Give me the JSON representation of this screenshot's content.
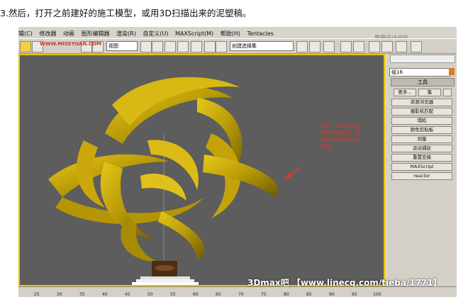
{
  "caption": "3.然后，打开之前建好的施工模型，或用3D扫描出来的泥塑稿。",
  "menu": [
    "辑(C)",
    "修改器",
    "动画",
    "图形编辑器",
    "渲染(R)",
    "自定义(U)",
    "MAXScript(M)",
    "帮助(H)",
    "Tentacles"
  ],
  "top_watermark": "思缘设计论坛",
  "toolbar": {
    "view_dropdown": "视图",
    "selection_dropdown": "创建选择集"
  },
  "left_watermark": "WWW.MISSYUAN.COM",
  "annotation": "模型，和所有模型都是重新建模。效果的模型和当前的模型。",
  "panel": {
    "name_field": "组16",
    "tools_header": "工具",
    "more_button": "更多...",
    "sets_button": "集",
    "items": [
      "资源浏览器",
      "摄影机匹配",
      "塌陷",
      "颜色剪贴板",
      "测量",
      "运动捕捉",
      "重置变换",
      "MAXScript",
      "reactor"
    ]
  },
  "footer_watermark": "3Dmax吧 【www.linecg.com/tieba/1771】",
  "ruler": [
    "25",
    "30",
    "35",
    "40",
    "45",
    "50",
    "55",
    "60",
    "65",
    "70",
    "75",
    "80",
    "85",
    "90",
    "95",
    "100"
  ],
  "colors": {
    "viewport_bg": "#5d5d5d",
    "sculpture": "#c8a800",
    "frame": "#e8c400",
    "note": "#d43b2e"
  }
}
